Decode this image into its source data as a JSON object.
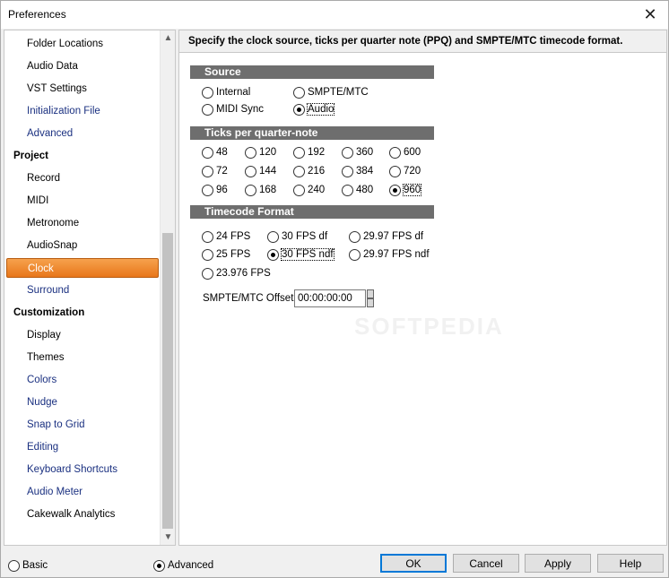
{
  "window": {
    "title": "Preferences",
    "close_glyph": "✕"
  },
  "tree": {
    "items": [
      {
        "label": "Folder Locations",
        "kind": "child"
      },
      {
        "label": "Audio Data",
        "kind": "child"
      },
      {
        "label": "VST Settings",
        "kind": "child"
      },
      {
        "label": "Initialization File",
        "kind": "link"
      },
      {
        "label": "Advanced",
        "kind": "link"
      },
      {
        "label": "Project",
        "kind": "group"
      },
      {
        "label": "Record",
        "kind": "child"
      },
      {
        "label": "MIDI",
        "kind": "child"
      },
      {
        "label": "Metronome",
        "kind": "child"
      },
      {
        "label": "AudioSnap",
        "kind": "child"
      },
      {
        "label": "Clock",
        "kind": "selected"
      },
      {
        "label": "Surround",
        "kind": "link"
      },
      {
        "label": "Customization",
        "kind": "group"
      },
      {
        "label": "Display",
        "kind": "child"
      },
      {
        "label": "Themes",
        "kind": "child"
      },
      {
        "label": "Colors",
        "kind": "link"
      },
      {
        "label": "Nudge",
        "kind": "link"
      },
      {
        "label": "Snap to Grid",
        "kind": "link"
      },
      {
        "label": "Editing",
        "kind": "link"
      },
      {
        "label": "Keyboard Shortcuts",
        "kind": "link"
      },
      {
        "label": "Audio Meter",
        "kind": "link"
      },
      {
        "label": "Cakewalk Analytics",
        "kind": "child"
      }
    ],
    "scroll_up": "▲",
    "scroll_down": "▼"
  },
  "main": {
    "header": "Specify the clock source, ticks per quarter note (PPQ) and SMPTE/MTC  timecode format.",
    "source": {
      "title": "Source",
      "options": [
        {
          "label": "Internal",
          "checked": false
        },
        {
          "label": "SMPTE/MTC",
          "checked": false
        },
        {
          "label": "MIDI Sync",
          "checked": false
        },
        {
          "label": "Audio",
          "checked": true
        }
      ]
    },
    "ticks": {
      "title": "Ticks per quarter-note",
      "options": [
        {
          "label": "48",
          "checked": false
        },
        {
          "label": "120",
          "checked": false
        },
        {
          "label": "192",
          "checked": false
        },
        {
          "label": "360",
          "checked": false
        },
        {
          "label": "600",
          "checked": false
        },
        {
          "label": "72",
          "checked": false
        },
        {
          "label": "144",
          "checked": false
        },
        {
          "label": "216",
          "checked": false
        },
        {
          "label": "384",
          "checked": false
        },
        {
          "label": "720",
          "checked": false
        },
        {
          "label": "96",
          "checked": false
        },
        {
          "label": "168",
          "checked": false
        },
        {
          "label": "240",
          "checked": false
        },
        {
          "label": "480",
          "checked": false
        },
        {
          "label": "960",
          "checked": true
        }
      ]
    },
    "timecode": {
      "title": "Timecode Format",
      "options": [
        {
          "label": "24 FPS",
          "checked": false
        },
        {
          "label": "30 FPS df",
          "checked": false
        },
        {
          "label": "29.97 FPS df",
          "checked": false
        },
        {
          "label": "25 FPS",
          "checked": false
        },
        {
          "label": "30 FPS ndf",
          "checked": true
        },
        {
          "label": "29.97 FPS ndf",
          "checked": false
        },
        {
          "label": "23.976 FPS",
          "checked": false
        }
      ]
    },
    "offset": {
      "label": "SMPTE/MTC Offset:",
      "value": "00:00:00:00"
    },
    "watermark": "SOFTPEDIA"
  },
  "footer": {
    "basic_label": "Basic",
    "advanced_label": "Advanced",
    "advanced_checked": true,
    "ok_label": "OK",
    "cancel_label": "Cancel",
    "apply_label": "Apply",
    "help_label": "Help"
  }
}
